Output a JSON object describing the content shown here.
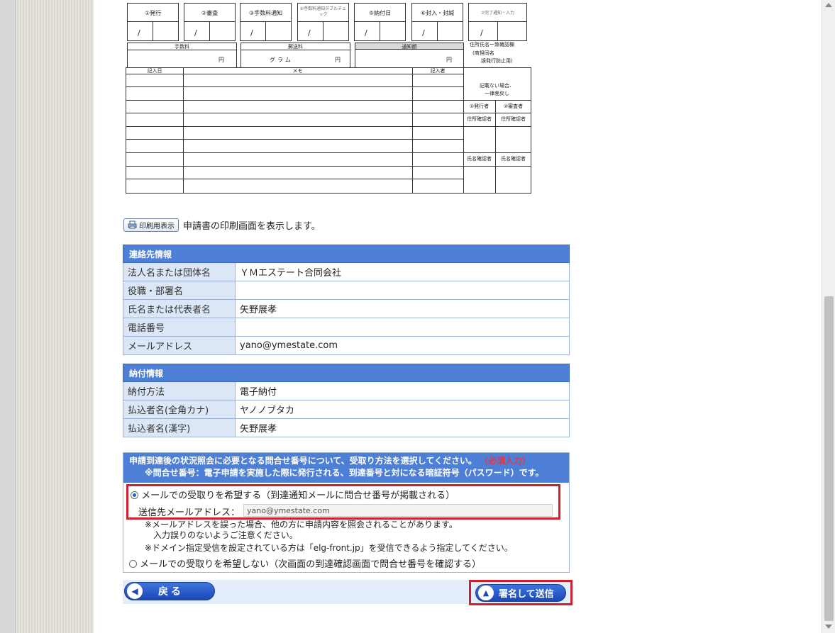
{
  "form_preview": {
    "steps": [
      "①発行",
      "②審査",
      "③手数料通知",
      "④手数料通知ダブルチェック",
      "⑤納付日",
      "⑥封入・封緘",
      "⑦完了通知・入力"
    ],
    "slash": "/",
    "fee_label": "手数料",
    "postage_label": "郵送料",
    "tax_label": "通知額",
    "yen": "円",
    "gram": "グラム",
    "address_note_1": "住所氏名ー致確認欄",
    "address_note_2": "(商担同名",
    "address_note_3": "誤発行防止用)",
    "entry_date": "記入日",
    "memo": "メモ",
    "entrant": "記入者",
    "mismatch_1": "記載ない場合、",
    "mismatch_2": "一律差戻し",
    "issuer": "①発行者",
    "reviewer": "②審査者",
    "address_checker": "住所確認者",
    "name_checker": "氏名確認者"
  },
  "print": {
    "button_label": "印刷用表示",
    "description": "申請書の印刷画面を表示します。"
  },
  "contact": {
    "heading": "連絡先情報",
    "rows": [
      {
        "label": "法人名または団体名",
        "value": "ＹＭエステート合同会社"
      },
      {
        "label": "役職・部署名",
        "value": ""
      },
      {
        "label": "氏名または代表者名",
        "value": "矢野展孝"
      },
      {
        "label": "電話番号",
        "value": ""
      },
      {
        "label": "メールアドレス",
        "value": "yano@ymestate.com"
      }
    ]
  },
  "payment": {
    "heading": "納付情報",
    "rows": [
      {
        "label": "納付方法",
        "value": "電子納付"
      },
      {
        "label": "払込者名(全角カナ)",
        "value": "ヤノノブタカ"
      },
      {
        "label": "払込者名(漢字)",
        "value": "矢野展孝"
      }
    ]
  },
  "inquiry": {
    "heading": "申請到達後の状況照会に必要となる問合せ番号について、受取り方法を選択してください。",
    "required": "（必須入力）",
    "note": "※問合せ番号：電子申請を実施した際に発行される、到達番号と対になる暗証符号（パスワード）です。",
    "option_email": "メールでの受取りを希望する（到達通知メールに問合せ番号が掲載される）",
    "email_field_label": "送信先メールアドレス：",
    "email_value": "yano@ymestate.com",
    "warning_1": "※メールアドレスを誤った場合、他の方に申請内容を照会されることがあります。",
    "warning_2": "入力誤りのないようご注意ください。",
    "warning_3": "※ドメイン指定受信を設定されている方は「elg-front.jp」を受信できるよう指定してください。",
    "option_no_email": "メールでの受取りを希望しない（次画面の到達確認画面で問合せ番号を確認する）"
  },
  "buttons": {
    "back": "戻る",
    "submit": "署名して送信"
  }
}
